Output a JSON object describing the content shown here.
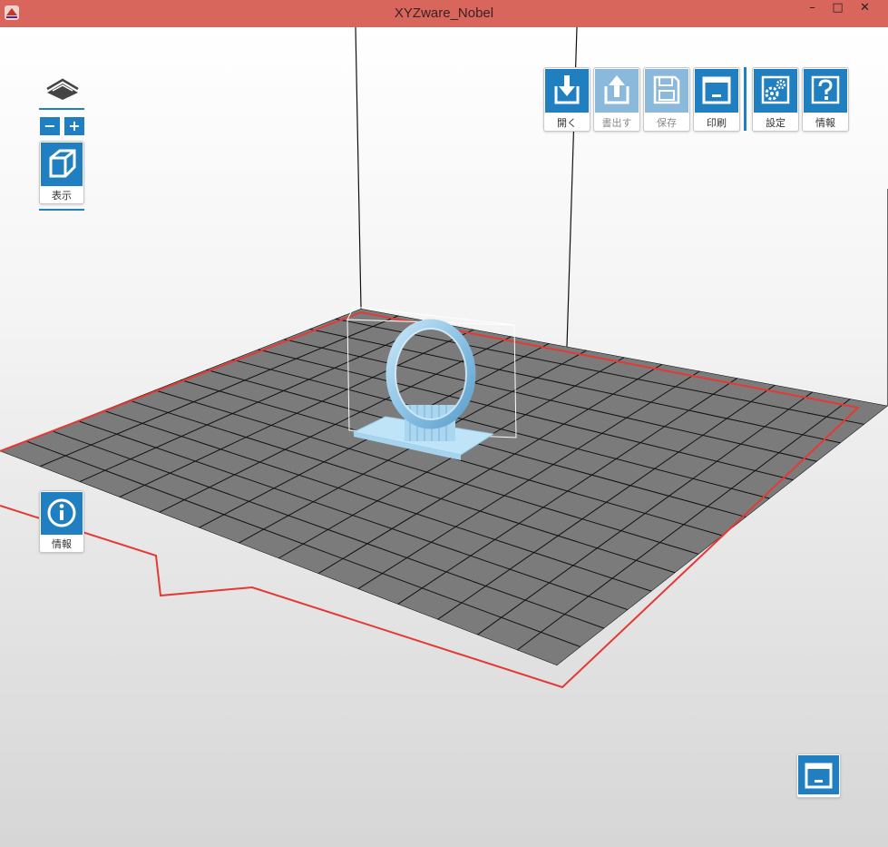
{
  "window": {
    "title": "XYZware_Nobel",
    "minimize": "–",
    "maximize": "□",
    "close": "✕"
  },
  "left_panel": {
    "zoom_out": "−",
    "zoom_in": "+",
    "view_label": "表示",
    "info_label": "情報"
  },
  "toolbar": {
    "open_label": "開く",
    "export_label": "書出す",
    "save_label": "保存",
    "print_label": "印刷",
    "settings_label": "設定",
    "info_label": "情報"
  },
  "icons": [
    "layers-icon",
    "cube-view-icon",
    "info-circle-icon",
    "open-import-icon",
    "export-icon",
    "save-icon",
    "print-icon",
    "settings-gears-icon",
    "help-question-icon",
    "print-preview-icon"
  ],
  "colors": {
    "titlebar": "#d8665c",
    "accent": "#1f7fc0",
    "accent_disabled": "#8ab9dc",
    "plate": "#7a7a7a",
    "boundary": "#e53935",
    "model": "#9ccbe8"
  }
}
